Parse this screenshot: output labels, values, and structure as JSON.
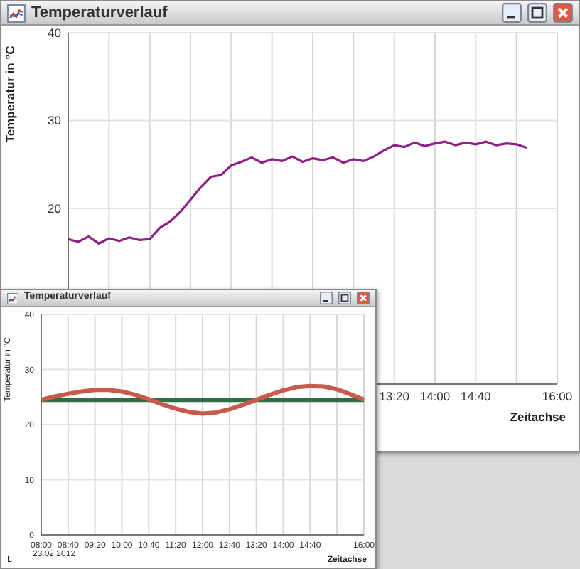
{
  "windows": [
    {
      "title": "Temperaturverlauf",
      "chart_data": {
        "type": "line",
        "xlabel": "Zeitachse",
        "ylabel": "Temperatur in °C",
        "categories": [
          null,
          null,
          null,
          null,
          null,
          null,
          null,
          null,
          null,
          null,
          null,
          null,
          null,
          null,
          null,
          null,
          null,
          null,
          null,
          null,
          null,
          null,
          null,
          null,
          null,
          null,
          null,
          null,
          null,
          null,
          null,
          null,
          "13:20",
          null,
          null,
          null,
          "14:00",
          null,
          null,
          null,
          "14:40",
          null,
          null,
          null,
          null,
          null,
          null,
          null,
          "16:00"
        ],
        "series": [
          {
            "color": "#8e1f86",
            "values": [
              16.5,
              16.2,
              16.8,
              16.0,
              16.6,
              16.3,
              16.7,
              16.4,
              16.5,
              17.8,
              18.5,
              19.6,
              21.0,
              22.4,
              23.6,
              23.8,
              24.9,
              25.3,
              25.8,
              25.2,
              25.6,
              25.4,
              25.9,
              25.3,
              25.7,
              25.5,
              25.8,
              25.2,
              25.6,
              25.4,
              25.9,
              26.6,
              27.2,
              27.0,
              27.5,
              27.1,
              27.4,
              27.6,
              27.2,
              27.5,
              27.3,
              27.6,
              27.2,
              27.4,
              27.3,
              26.9,
              null,
              null,
              null
            ]
          }
        ],
        "ylim": [
          0,
          40
        ],
        "yticks": [
          20,
          30,
          40
        ],
        "grid": true
      }
    },
    {
      "title": "Temperaturverlauf",
      "date_label": "23.02.2012",
      "corner_label": "L",
      "chart_data": {
        "type": "line",
        "xlabel": "Zeitachse",
        "ylabel": "Temperatur in °C",
        "categories": [
          "08:00",
          null,
          "08:40",
          null,
          "09:20",
          null,
          "10:00",
          null,
          "10:40",
          null,
          "11:20",
          null,
          "12:00",
          null,
          "12:40",
          null,
          "13:20",
          null,
          "14:00",
          null,
          "14:40",
          null,
          null,
          null,
          "16:00"
        ],
        "series": [
          {
            "color": "#c85a4c",
            "values": [
              24.5,
              25.1,
              25.6,
              26.0,
              26.3,
              26.3,
              26.0,
              25.4,
              24.6,
              23.7,
              22.9,
              22.3,
              22.0,
              22.2,
              22.8,
              23.6,
              24.5,
              25.4,
              26.2,
              26.8,
              27.0,
              26.9,
              26.4,
              25.5,
              24.5
            ]
          },
          {
            "color": "#2f6e44",
            "values": [
              24.5,
              24.5,
              24.5,
              24.5,
              24.5,
              24.5,
              24.5,
              24.5,
              24.5,
              24.5,
              24.5,
              24.5,
              24.5,
              24.5,
              24.5,
              24.5,
              24.5,
              24.5,
              24.5,
              24.5,
              24.5,
              24.5,
              24.5,
              24.5,
              24.5
            ]
          }
        ],
        "ylim": [
          0,
          40
        ],
        "yticks": [
          0,
          10,
          20,
          30,
          40
        ],
        "grid": true
      }
    }
  ]
}
